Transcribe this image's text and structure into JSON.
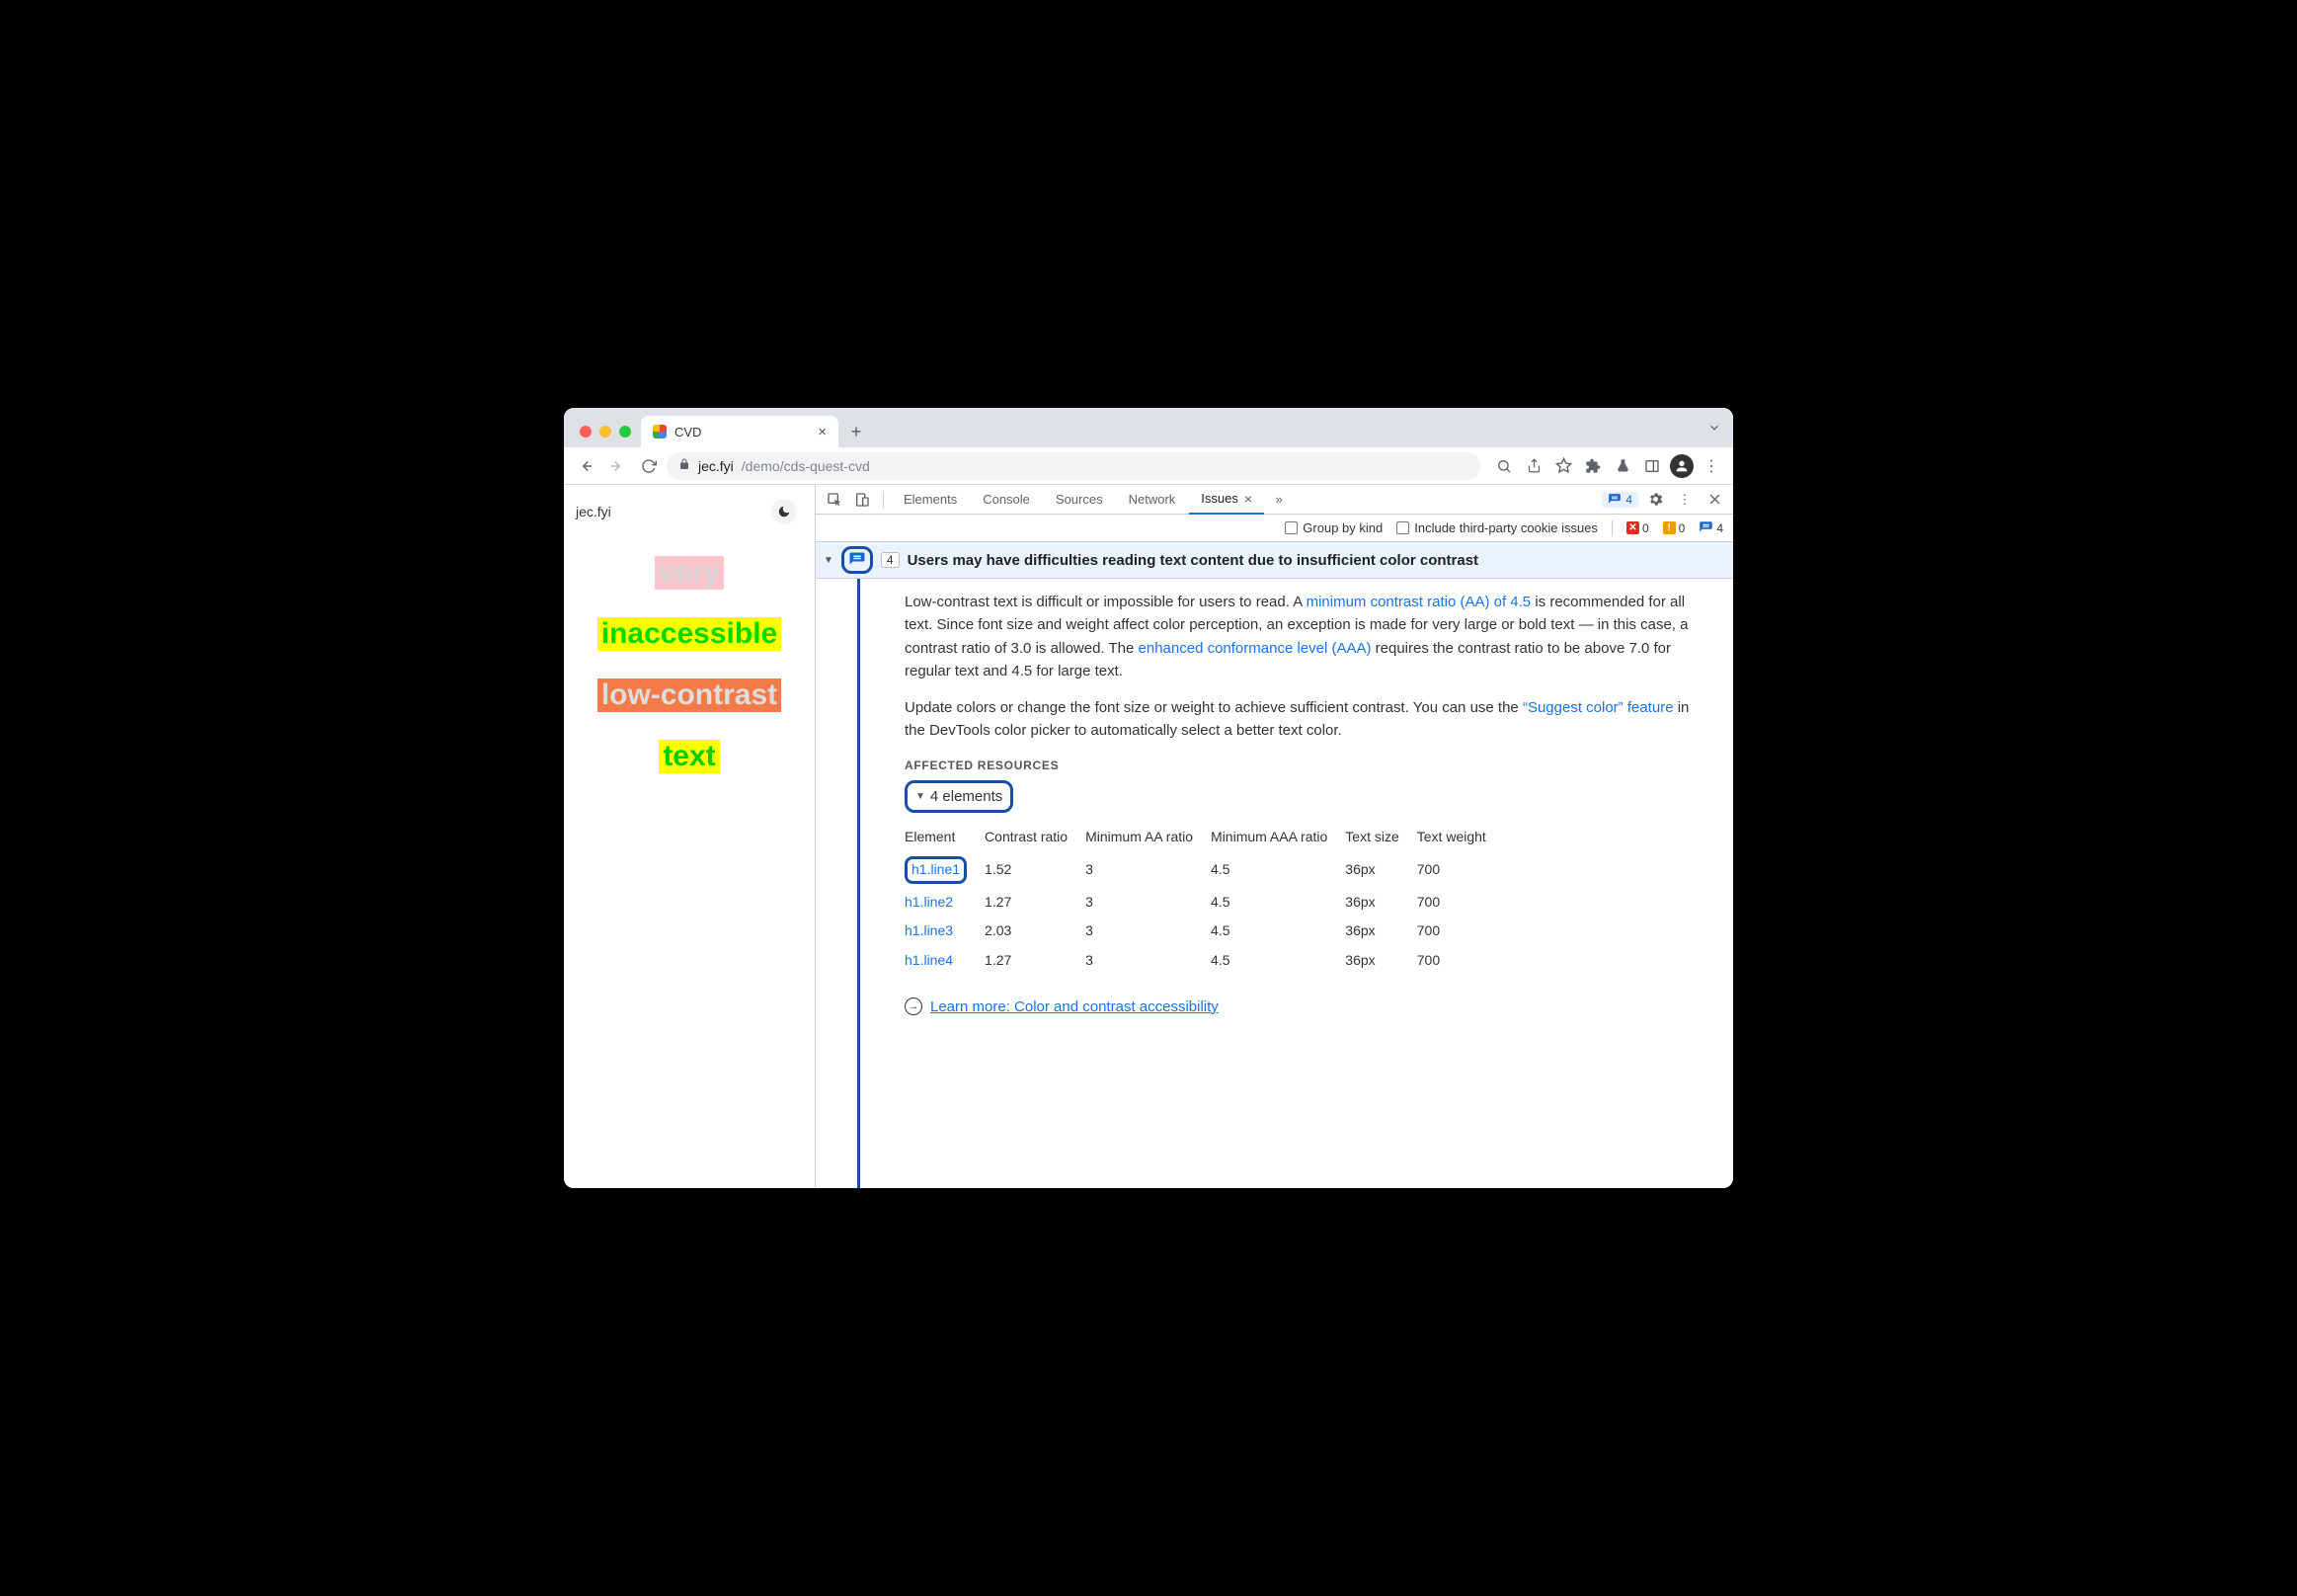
{
  "browser": {
    "tab_title": "CVD",
    "url_host": "jec.fyi",
    "url_path": "/demo/cds-quest-cvd"
  },
  "page": {
    "site_label": "jec.fyi",
    "lines": [
      "very",
      "inaccessible",
      "low-contrast",
      "text"
    ]
  },
  "devtools": {
    "tabs": [
      "Elements",
      "Console",
      "Sources",
      "Network",
      "Issues"
    ],
    "active_tab": "Issues",
    "panel_chip_count": "4",
    "filters": {
      "group_by_kind": "Group by kind",
      "third_party": "Include third-party cookie issues"
    },
    "counters": {
      "red": "0",
      "yellow": "0",
      "blue": "4"
    }
  },
  "issue": {
    "count": "4",
    "title": "Users may have difficulties reading text content due to insufficient color contrast",
    "p1_a": "Low-contrast text is difficult or impossible for users to read. A ",
    "p1_link": "minimum contrast ratio (AA) of 4.5",
    "p1_b": " is recommended for all text. Since font size and weight affect color perception, an exception is made for very large or bold text — in this case, a contrast ratio of 3.0 is allowed. The ",
    "p1_link2": "enhanced conformance level (AAA)",
    "p1_c": " requires the contrast ratio to be above 7.0 for regular text and 4.5 for large text.",
    "p2_a": "Update colors or change the font size or weight to achieve sufficient contrast. You can use the ",
    "p2_link": "“Suggest color” feature",
    "p2_b": " in the DevTools color picker to automatically select a better text color.",
    "affected_label": "Affected Resources",
    "elements_summary": "4 elements",
    "table": {
      "headers": [
        "Element",
        "Contrast ratio",
        "Minimum AA ratio",
        "Minimum AAA ratio",
        "Text size",
        "Text weight"
      ],
      "rows": [
        {
          "el": "h1.line1",
          "cr": "1.52",
          "aa": "3",
          "aaa": "4.5",
          "size": "36px",
          "weight": "700"
        },
        {
          "el": "h1.line2",
          "cr": "1.27",
          "aa": "3",
          "aaa": "4.5",
          "size": "36px",
          "weight": "700"
        },
        {
          "el": "h1.line3",
          "cr": "2.03",
          "aa": "3",
          "aaa": "4.5",
          "size": "36px",
          "weight": "700"
        },
        {
          "el": "h1.line4",
          "cr": "1.27",
          "aa": "3",
          "aaa": "4.5",
          "size": "36px",
          "weight": "700"
        }
      ]
    },
    "learn_more": "Learn more: Color and contrast accessibility"
  }
}
